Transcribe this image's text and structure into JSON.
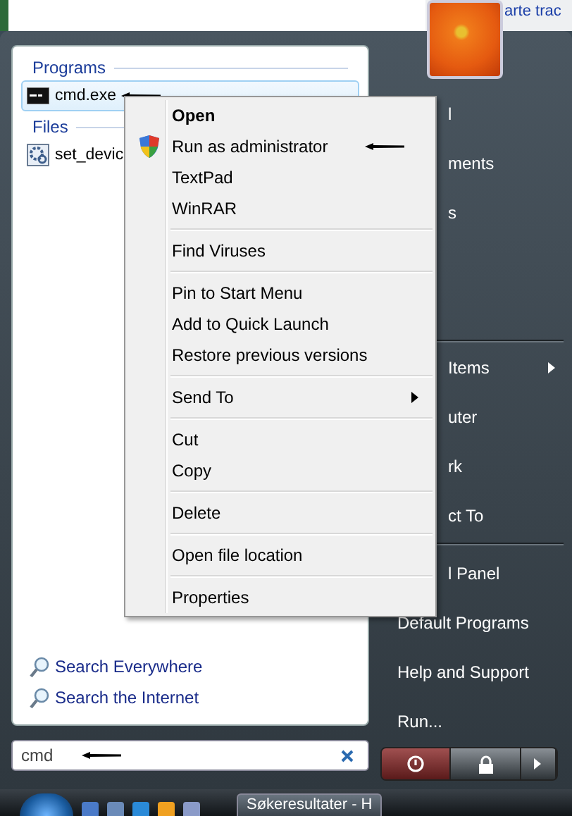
{
  "background_window": {
    "text": "arte trac"
  },
  "left_panel": {
    "sections": [
      {
        "heading": "Programs",
        "items": [
          {
            "label": "cmd.exe",
            "kind": "console",
            "selected": true,
            "arrow": true
          }
        ]
      },
      {
        "heading": "Files",
        "items": [
          {
            "label": "set_devic",
            "kind": "settings",
            "selected": false
          }
        ]
      }
    ],
    "links": [
      {
        "label": "Search Everywhere"
      },
      {
        "label": "Search the Internet"
      }
    ]
  },
  "search": {
    "value": "cmd",
    "arrow": true
  },
  "context_menu": {
    "items": [
      {
        "kind": "item",
        "label": "Open",
        "bold": true,
        "shield": false,
        "arrow": false,
        "submenu": false
      },
      {
        "kind": "item",
        "label": "Run as administrator",
        "bold": false,
        "shield": true,
        "arrow": true,
        "submenu": false
      },
      {
        "kind": "item",
        "label": "TextPad",
        "bold": false,
        "shield": false,
        "arrow": false,
        "submenu": false
      },
      {
        "kind": "item",
        "label": "WinRAR",
        "bold": false,
        "shield": false,
        "arrow": false,
        "submenu": false
      },
      {
        "kind": "separator"
      },
      {
        "kind": "item",
        "label": "Find Viruses",
        "bold": false,
        "shield": false,
        "arrow": false,
        "submenu": false
      },
      {
        "kind": "separator"
      },
      {
        "kind": "item",
        "label": "Pin to Start Menu",
        "bold": false,
        "shield": false,
        "arrow": false,
        "submenu": false
      },
      {
        "kind": "item",
        "label": "Add to Quick Launch",
        "bold": false,
        "shield": false,
        "arrow": false,
        "submenu": false
      },
      {
        "kind": "item",
        "label": "Restore previous versions",
        "bold": false,
        "shield": false,
        "arrow": false,
        "submenu": false
      },
      {
        "kind": "separator"
      },
      {
        "kind": "item",
        "label": "Send To",
        "bold": false,
        "shield": false,
        "arrow": false,
        "submenu": true
      },
      {
        "kind": "separator"
      },
      {
        "kind": "item",
        "label": "Cut",
        "bold": false,
        "shield": false,
        "arrow": false,
        "submenu": false
      },
      {
        "kind": "item",
        "label": "Copy",
        "bold": false,
        "shield": false,
        "arrow": false,
        "submenu": false
      },
      {
        "kind": "separator"
      },
      {
        "kind": "item",
        "label": "Delete",
        "bold": false,
        "shield": false,
        "arrow": false,
        "submenu": false
      },
      {
        "kind": "separator"
      },
      {
        "kind": "item",
        "label": "Open file location",
        "bold": false,
        "shield": false,
        "arrow": false,
        "submenu": false
      },
      {
        "kind": "separator"
      },
      {
        "kind": "item",
        "label": "Properties",
        "bold": false,
        "shield": false,
        "arrow": false,
        "submenu": false
      }
    ]
  },
  "right_panel": {
    "items": [
      {
        "kind": "covered",
        "label": "l",
        "submenu": false
      },
      {
        "kind": "covered",
        "label": "ments",
        "submenu": false
      },
      {
        "kind": "covered",
        "label": "s",
        "submenu": false
      },
      {
        "kind": "separator"
      },
      {
        "kind": "covered",
        "label": "Items",
        "submenu": true
      },
      {
        "kind": "covered",
        "label": "uter",
        "submenu": false
      },
      {
        "kind": "covered",
        "label": "rk",
        "submenu": false
      },
      {
        "kind": "covered",
        "label": "ct To",
        "submenu": false
      },
      {
        "kind": "separator"
      },
      {
        "kind": "covered",
        "label": "l Panel",
        "submenu": false
      },
      {
        "kind": "full",
        "label": "Default Programs",
        "submenu": false
      },
      {
        "kind": "full",
        "label": "Help and Support",
        "submenu": false
      },
      {
        "kind": "full",
        "label": "Run...",
        "submenu": false
      }
    ]
  },
  "taskbar": {
    "window_button": "Søkeresultater - H"
  }
}
